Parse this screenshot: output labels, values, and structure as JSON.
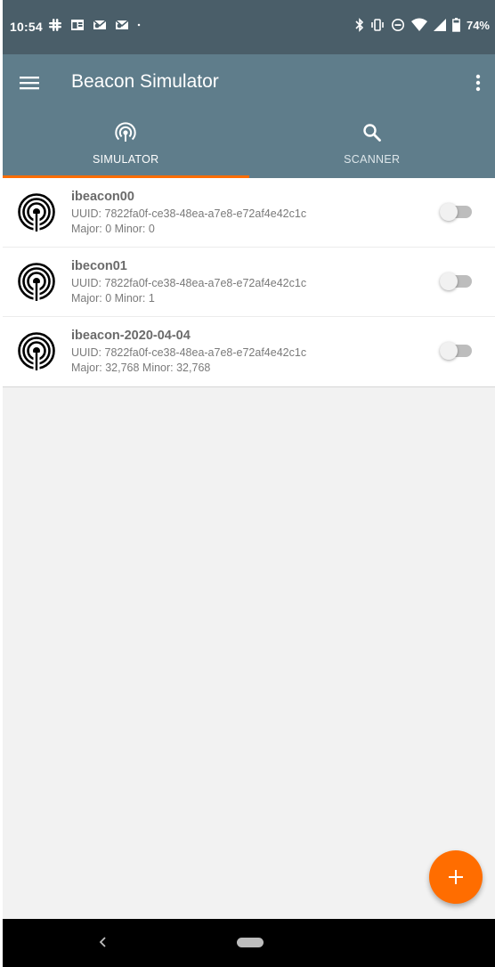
{
  "status_bar": {
    "time": "10:54",
    "notification_icons": [
      "slack-icon",
      "calendar-icon",
      "outlook-icon",
      "outlook-icon",
      "dot-icon"
    ],
    "system_icons": [
      "bluetooth-icon",
      "vibrate-icon",
      "do-not-disturb-icon",
      "wifi-icon",
      "signal-icon",
      "battery-icon"
    ],
    "battery": "74%"
  },
  "app_bar": {
    "title": "Beacon Simulator",
    "background_color": "#5f7d8b"
  },
  "tabs": [
    {
      "label": "SIMULATOR",
      "icon": "broadcast-icon",
      "active": true
    },
    {
      "label": "SCANNER",
      "icon": "search-icon",
      "active": false
    }
  ],
  "accent_color": "#ff6d00",
  "beacons": [
    {
      "name": "ibeacon00",
      "uuid": "UUID: 7822fa0f-ce38-48ea-a7e8-e72af4e42c1c",
      "major_minor": "Major: 0 Minor: 0",
      "enabled": false
    },
    {
      "name": "ibecon01",
      "uuid": "UUID: 7822fa0f-ce38-48ea-a7e8-e72af4e42c1c",
      "major_minor": "Major: 0 Minor: 1",
      "enabled": false
    },
    {
      "name": "ibeacon-2020-04-04",
      "uuid": "UUID: 7822fa0f-ce38-48ea-a7e8-e72af4e42c1c",
      "major_minor": "Major: 32,768 Minor: 32,768",
      "enabled": false
    }
  ],
  "fab": {
    "icon": "plus-icon"
  },
  "nav_bar": {
    "back_icon": "back-icon",
    "home_icon": "home-pill-icon"
  }
}
